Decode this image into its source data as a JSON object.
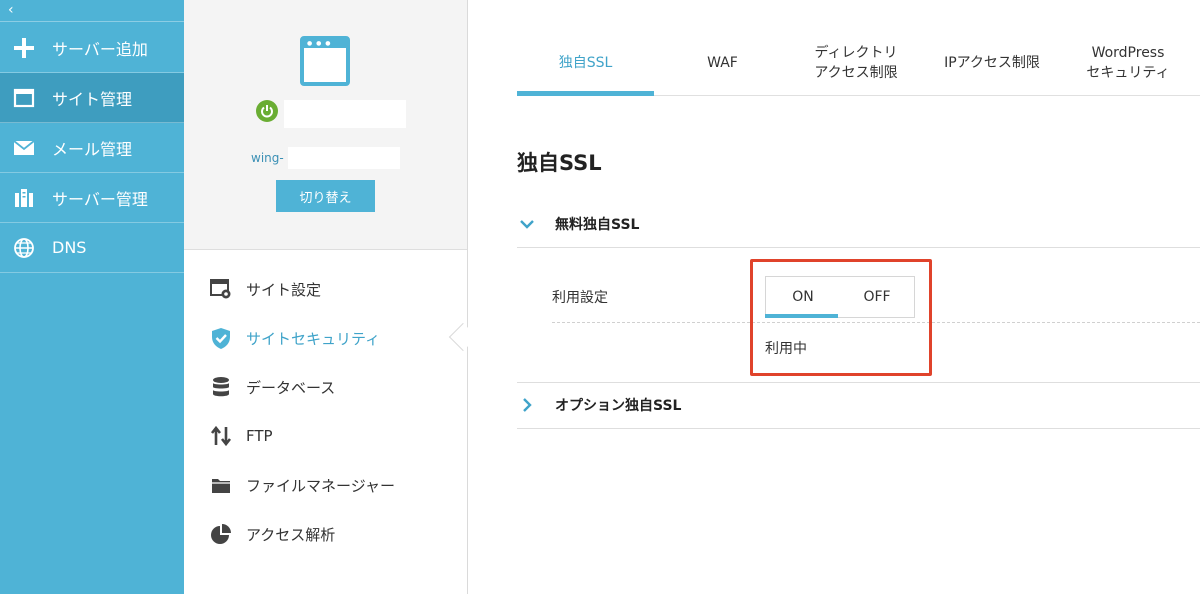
{
  "sidebar": {
    "collapse_glyph": "‹",
    "items": [
      {
        "label": "サーバー追加",
        "icon": "plus-icon"
      },
      {
        "label": "サイト管理",
        "icon": "window-icon",
        "active": true
      },
      {
        "label": "メール管理",
        "icon": "mail-icon"
      },
      {
        "label": "サーバー管理",
        "icon": "server-icon"
      },
      {
        "label": "DNS",
        "icon": "globe-icon"
      }
    ]
  },
  "site_panel": {
    "wing_label": "wing-",
    "switch_button": "切り替え",
    "menu": [
      {
        "label": "サイト設定",
        "icon": "site-settings-icon"
      },
      {
        "label": "サイトセキュリティ",
        "icon": "shield-check-icon",
        "active": true
      },
      {
        "label": "データベース",
        "icon": "database-icon"
      },
      {
        "label": "FTP",
        "icon": "transfer-arrows-icon"
      },
      {
        "label": "ファイルマネージャー",
        "icon": "folder-icon"
      },
      {
        "label": "アクセス解析",
        "icon": "pie-chart-icon"
      }
    ]
  },
  "tabs": [
    {
      "label": "独自SSL",
      "active": true
    },
    {
      "label": "WAF"
    },
    {
      "label": "ディレクトリ\nアクセス制限"
    },
    {
      "label": "IPアクセス制限"
    },
    {
      "label": "WordPress\nセキュリティ"
    }
  ],
  "main": {
    "title": "独自SSL",
    "free_ssl": {
      "title": "無料独自SSL",
      "setting_label": "利用設定",
      "on_label": "ON",
      "off_label": "OFF",
      "selected": "ON",
      "status": "利用中"
    },
    "option_ssl": {
      "title": "オプション独自SSL"
    }
  },
  "colors": {
    "accent": "#4fb3d6",
    "sidebar_active": "#3e9dbf",
    "power_green": "#6aad33",
    "highlight_red": "#e0432b"
  }
}
